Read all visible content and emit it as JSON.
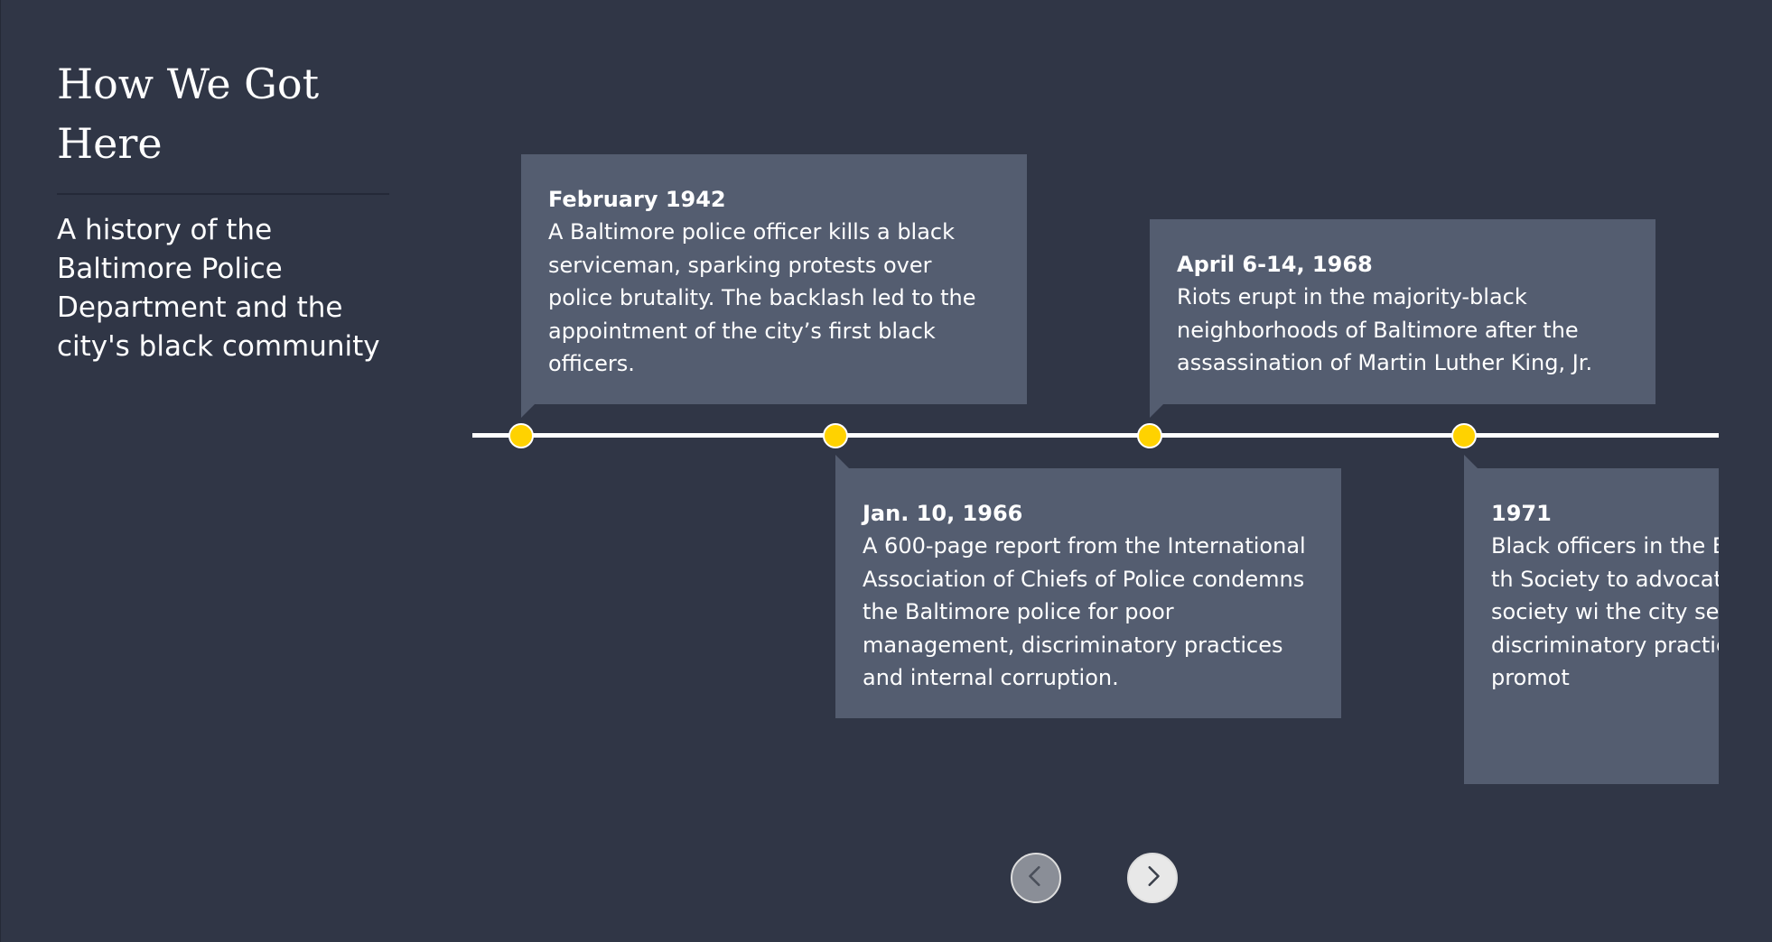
{
  "intro": {
    "title": "How We Got Here",
    "subtitle": "A history of the Baltimore Police Department and the city's black community"
  },
  "timeline": {
    "events": [
      {
        "date": "February 1942",
        "description": "A Baltimore police officer kills a black serviceman, sparking protests over police brutality. The backlash led to the appointment of the city’s first black officers."
      },
      {
        "date": "Jan. 10, 1966",
        "description": "A 600-page report from the International Association of Chiefs of Police condemns the Baltimore police for poor management, discriminatory practices and internal corruption."
      },
      {
        "date": "April 6-14, 1968",
        "description": "Riots erupt in the majority-black neighborhoods of Baltimore after the assassination of Martin Luther King, Jr."
      },
      {
        "date": "1971",
        "description": "Black officers in the B Department create th Society to advocate f rights. The society wi the city seven years l discriminatory practic are hired and promot"
      }
    ]
  },
  "colors": {
    "background": "#303646",
    "card": "#545d70",
    "marker": "#ffd200",
    "line": "#ffffff"
  },
  "icons": {
    "prev": "chevron-left-icon",
    "next": "chevron-right-icon"
  }
}
